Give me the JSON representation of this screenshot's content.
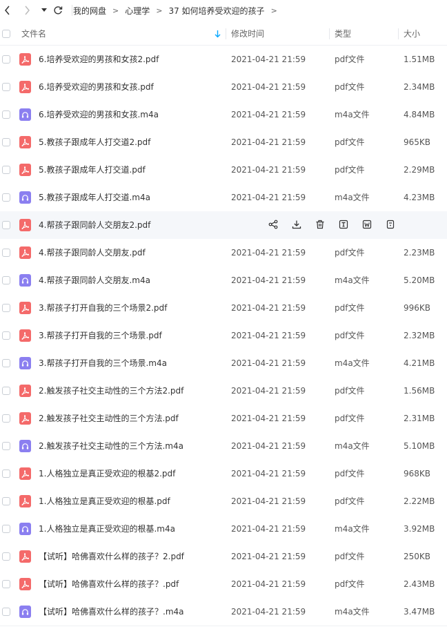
{
  "breadcrumb": [
    "我的网盘",
    "心理学",
    "37 如何培养受欢迎的孩子"
  ],
  "breadcrumb_sep": ">",
  "columns": {
    "name": "文件名",
    "modified": "修改时间",
    "type": "类型",
    "size": "大小"
  },
  "files": [
    {
      "name": "6.培养受欢迎的男孩和女孩2.pdf",
      "date": "2021-04-21 21:59",
      "type": "pdf文件",
      "size": "1.51MB",
      "kind": "pdf"
    },
    {
      "name": "6.培养受欢迎的男孩和女孩.pdf",
      "date": "2021-04-21 21:59",
      "type": "pdf文件",
      "size": "2.34MB",
      "kind": "pdf"
    },
    {
      "name": "6.培养受欢迎的男孩和女孩.m4a",
      "date": "2021-04-21 21:59",
      "type": "m4a文件",
      "size": "4.84MB",
      "kind": "m4a"
    },
    {
      "name": "5.教孩子跟成年人打交道2.pdf",
      "date": "2021-04-21 21:59",
      "type": "pdf文件",
      "size": "965KB",
      "kind": "pdf"
    },
    {
      "name": "5.教孩子跟成年人打交道.pdf",
      "date": "2021-04-21 21:59",
      "type": "pdf文件",
      "size": "2.29MB",
      "kind": "pdf"
    },
    {
      "name": "5.教孩子跟成年人打交道.m4a",
      "date": "2021-04-21 21:59",
      "type": "m4a文件",
      "size": "4.23MB",
      "kind": "m4a"
    },
    {
      "name": "4.帮孩子跟同龄人交朋友2.pdf",
      "date": "",
      "type": "",
      "size": "",
      "kind": "pdf",
      "hover": true
    },
    {
      "name": "4.帮孩子跟同龄人交朋友.pdf",
      "date": "2021-04-21 21:59",
      "type": "pdf文件",
      "size": "2.23MB",
      "kind": "pdf"
    },
    {
      "name": "4.帮孩子跟同龄人交朋友.m4a",
      "date": "2021-04-21 21:59",
      "type": "m4a文件",
      "size": "5.20MB",
      "kind": "m4a"
    },
    {
      "name": "3.帮孩子打开自我的三个场景2.pdf",
      "date": "2021-04-21 21:59",
      "type": "pdf文件",
      "size": "996KB",
      "kind": "pdf"
    },
    {
      "name": "3.帮孩子打开自我的三个场景.pdf",
      "date": "2021-04-21 21:59",
      "type": "pdf文件",
      "size": "2.32MB",
      "kind": "pdf"
    },
    {
      "name": "3.帮孩子打开自我的三个场景.m4a",
      "date": "2021-04-21 21:59",
      "type": "m4a文件",
      "size": "4.21MB",
      "kind": "m4a"
    },
    {
      "name": "2.触发孩子社交主动性的三个方法2.pdf",
      "date": "2021-04-21 21:59",
      "type": "pdf文件",
      "size": "1.56MB",
      "kind": "pdf"
    },
    {
      "name": "2.触发孩子社交主动性的三个方法.pdf",
      "date": "2021-04-21 21:59",
      "type": "pdf文件",
      "size": "2.31MB",
      "kind": "pdf"
    },
    {
      "name": "2.触发孩子社交主动性的三个方法.m4a",
      "date": "2021-04-21 21:59",
      "type": "m4a文件",
      "size": "5.10MB",
      "kind": "m4a"
    },
    {
      "name": "1.人格独立是真正受欢迎的根基2.pdf",
      "date": "2021-04-21 21:59",
      "type": "pdf文件",
      "size": "968KB",
      "kind": "pdf"
    },
    {
      "name": "1.人格独立是真正受欢迎的根基.pdf",
      "date": "2021-04-21 21:59",
      "type": "pdf文件",
      "size": "2.22MB",
      "kind": "pdf"
    },
    {
      "name": "1.人格独立是真正受欢迎的根基.m4a",
      "date": "2021-04-21 21:59",
      "type": "m4a文件",
      "size": "3.92MB",
      "kind": "m4a"
    },
    {
      "name": "【试听】哈佛喜欢什么样的孩子？2.pdf",
      "date": "2021-04-21 21:59",
      "type": "pdf文件",
      "size": "250KB",
      "kind": "pdf"
    },
    {
      "name": "【试听】哈佛喜欢什么样的孩子？.pdf",
      "date": "2021-04-21 21:59",
      "type": "pdf文件",
      "size": "2.43MB",
      "kind": "pdf"
    },
    {
      "name": "【试听】哈佛喜欢什么样的孩子？.m4a",
      "date": "2021-04-21 21:59",
      "type": "m4a文件",
      "size": "3.47MB",
      "kind": "m4a"
    }
  ],
  "colors": {
    "pdf_icon": "#f46a6a",
    "m4a_icon": "#8b7ff0",
    "sort_arrow": "#06a7ff"
  },
  "icons": {
    "back": "chevron-left-icon",
    "forward": "chevron-right-icon",
    "history": "caret-down-icon",
    "refresh": "refresh-icon",
    "row_actions": [
      "share-icon",
      "download-icon",
      "delete-icon",
      "text-icon",
      "word-icon",
      "more-icon"
    ]
  }
}
